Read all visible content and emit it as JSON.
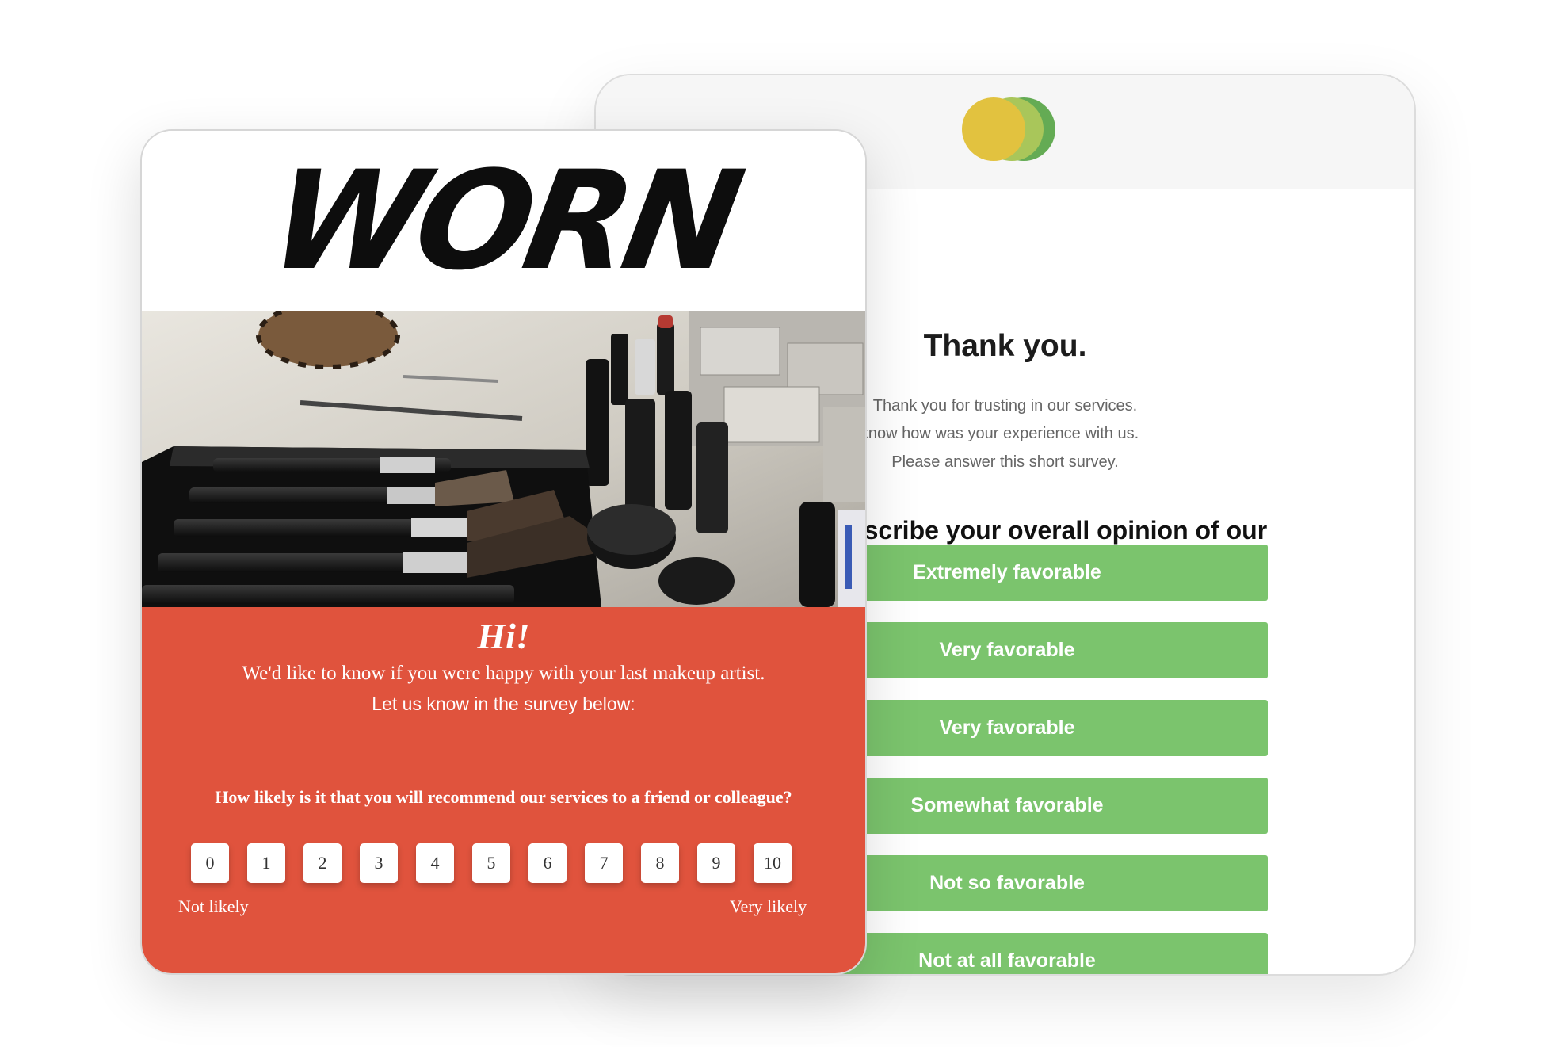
{
  "brand_card": {
    "logo_text": "WORN",
    "greeting": "Hi!",
    "intro_line1": "We'd like to know if you were happy with your last makeup artist.",
    "intro_line2": "Let us know in the survey below:",
    "nps_question": "How likely is it that you will recommend our services to a friend or colleague?",
    "scale": [
      "0",
      "1",
      "2",
      "3",
      "4",
      "5",
      "6",
      "7",
      "8",
      "9",
      "10"
    ],
    "scale_low_label": "Not likely",
    "scale_high_label": "Very likely",
    "accent_color": "#e0533d"
  },
  "survey_card": {
    "logo_colors": [
      "#e2c23f",
      "#a9c65a",
      "#64ab54"
    ],
    "title": "Thank you.",
    "line1": "Thank you for trusting in our services.",
    "line2": "ove to know how was your experience with us.",
    "line3": "Please answer this short survey.",
    "question": "u describe your overall opinion of our brand?",
    "options": [
      "Extremely favorable",
      "Very favorable",
      "Very favorable",
      "Somewhat favorable",
      "Not so favorable",
      "Not at all favorable"
    ],
    "button_color": "#7bc46d"
  }
}
